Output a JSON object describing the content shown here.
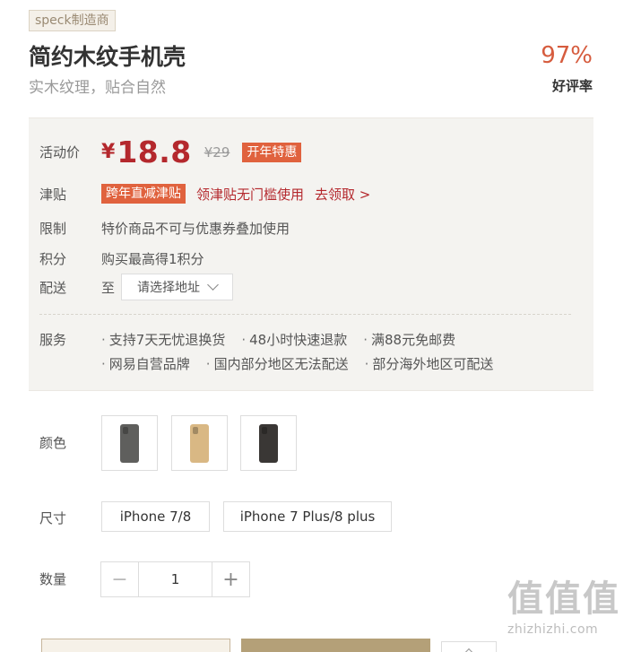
{
  "header": {
    "maker_tag": "speck制造商",
    "title": "简约木纹手机壳",
    "subtitle": "实木纹理，贴合自然",
    "rating_percent": "97%",
    "rating_label": "好评率"
  },
  "info": {
    "price_label": "活动价",
    "currency": "¥",
    "price": "18.8",
    "original_price": "¥29",
    "price_badge": "开年特惠",
    "subsidy_label": "津贴",
    "subsidy_badge": "跨年直减津贴",
    "subsidy_text": "领津贴无门槛使用",
    "subsidy_link": "去领取 >",
    "limit_label": "限制",
    "limit_text": "特价商品不可与优惠券叠加使用",
    "points_label": "积分",
    "points_text": "购买最高得1积分",
    "delivery_label": "配送",
    "delivery_to": "至",
    "address_placeholder": "请选择地址",
    "service_label": "服务",
    "services": [
      "支持7天无忧退换货",
      "48小时快速退款",
      "满88元免邮费",
      "网易自营品牌",
      "国内部分地区无法配送",
      "部分海外地区可配送"
    ]
  },
  "options": {
    "color_label": "颜色",
    "colors": [
      {
        "name": "gray",
        "hex": "#5f5f5d"
      },
      {
        "name": "wood",
        "hex": "#d9b884"
      },
      {
        "name": "black",
        "hex": "#3a3735"
      }
    ],
    "size_label": "尺寸",
    "sizes": [
      "iPhone 7/8",
      "iPhone 7 Plus/8 plus"
    ],
    "qty_label": "数量",
    "qty_minus": "−",
    "qty_value": "1",
    "qty_plus": "+"
  },
  "watermark": {
    "glyphs": "值值值",
    "url": "zhizhizhi.com"
  }
}
